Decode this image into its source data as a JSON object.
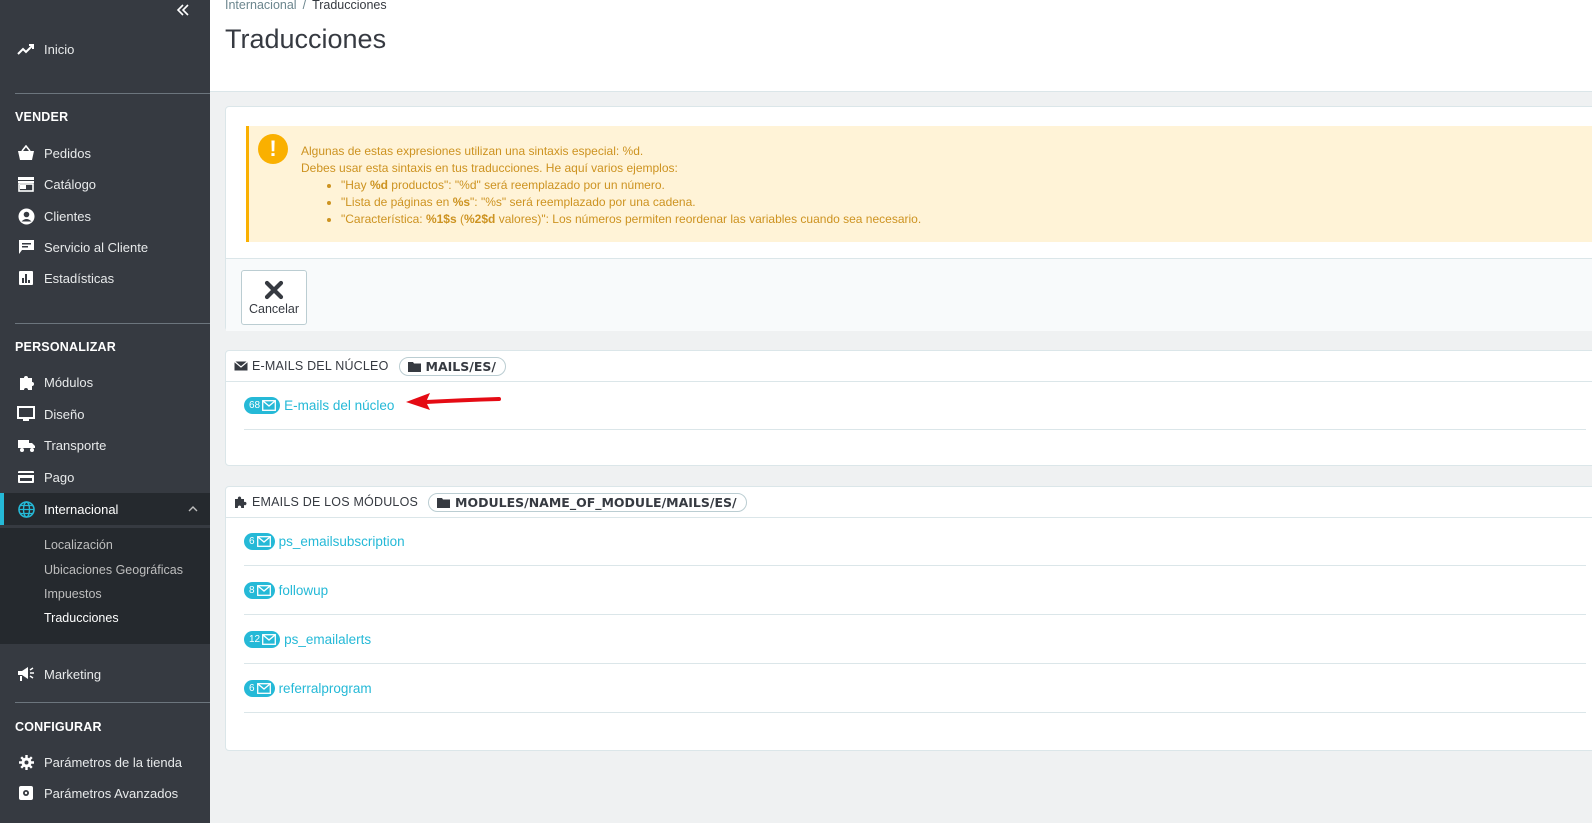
{
  "sidebar": {
    "home": "Inicio",
    "sections": {
      "sell": "VENDER",
      "customize": "PERSONALIZAR",
      "configure": "CONFIGURAR"
    },
    "sell_items": [
      "Pedidos",
      "Catálogo",
      "Clientes",
      "Servicio al Cliente",
      "Estadísticas"
    ],
    "customize_items": [
      "Módulos",
      "Diseño",
      "Transporte",
      "Pago",
      "Internacional"
    ],
    "international_sub": [
      "Localización",
      "Ubicaciones Geográficas",
      "Impuestos",
      "Traducciones"
    ],
    "marketing": "Marketing",
    "configure_items": [
      "Parámetros de la tienda",
      "Parámetros Avanzados"
    ]
  },
  "header": {
    "breadcrumb_parent": "Internacional",
    "breadcrumb_sep": "/",
    "breadcrumb_current": "Traducciones",
    "title": "Traducciones"
  },
  "alert": {
    "line1": "Algunas de estas expresiones utilizan una sintaxis especial: %d.",
    "line2": "Debes usar esta sintaxis en tus traducciones. He aquí varios ejemplos:",
    "ex1_a": "\"Hay ",
    "ex1_b": "%d",
    "ex1_c": " productos\": \"%d\" será reemplazado por un número.",
    "ex2_a": "\"Lista de páginas en ",
    "ex2_b": "%s",
    "ex2_c": "\": \"%s\" será reemplazado por una cadena.",
    "ex3_a": "\"Característica: ",
    "ex3_b": "%1$s",
    "ex3_c": " (",
    "ex3_d": "%2$d",
    "ex3_e": " valores)\": Los números permiten reordenar las variables cuando sea necesario."
  },
  "toolbar": {
    "cancel_label": "Cancelar"
  },
  "core_emails": {
    "title": "E-MAILS DEL NÚCLEO",
    "path": "MAILS/ES/",
    "items": [
      {
        "count": "68",
        "label": "E-mails del núcleo"
      }
    ]
  },
  "module_emails": {
    "title": "EMAILS DE LOS MÓDULOS",
    "path": "MODULES/NAME_OF_MODULE/MAILS/ES/",
    "items": [
      {
        "count": "6",
        "label": "ps_emailsubscription"
      },
      {
        "count": "8",
        "label": "followup"
      },
      {
        "count": "12",
        "label": "ps_emailalerts"
      },
      {
        "count": "6",
        "label": "referralprogram"
      }
    ]
  },
  "colors": {
    "accent": "#25b9d7",
    "sidebar": "#363a41",
    "warning": "#fab000",
    "arrow": "#e50b14"
  }
}
